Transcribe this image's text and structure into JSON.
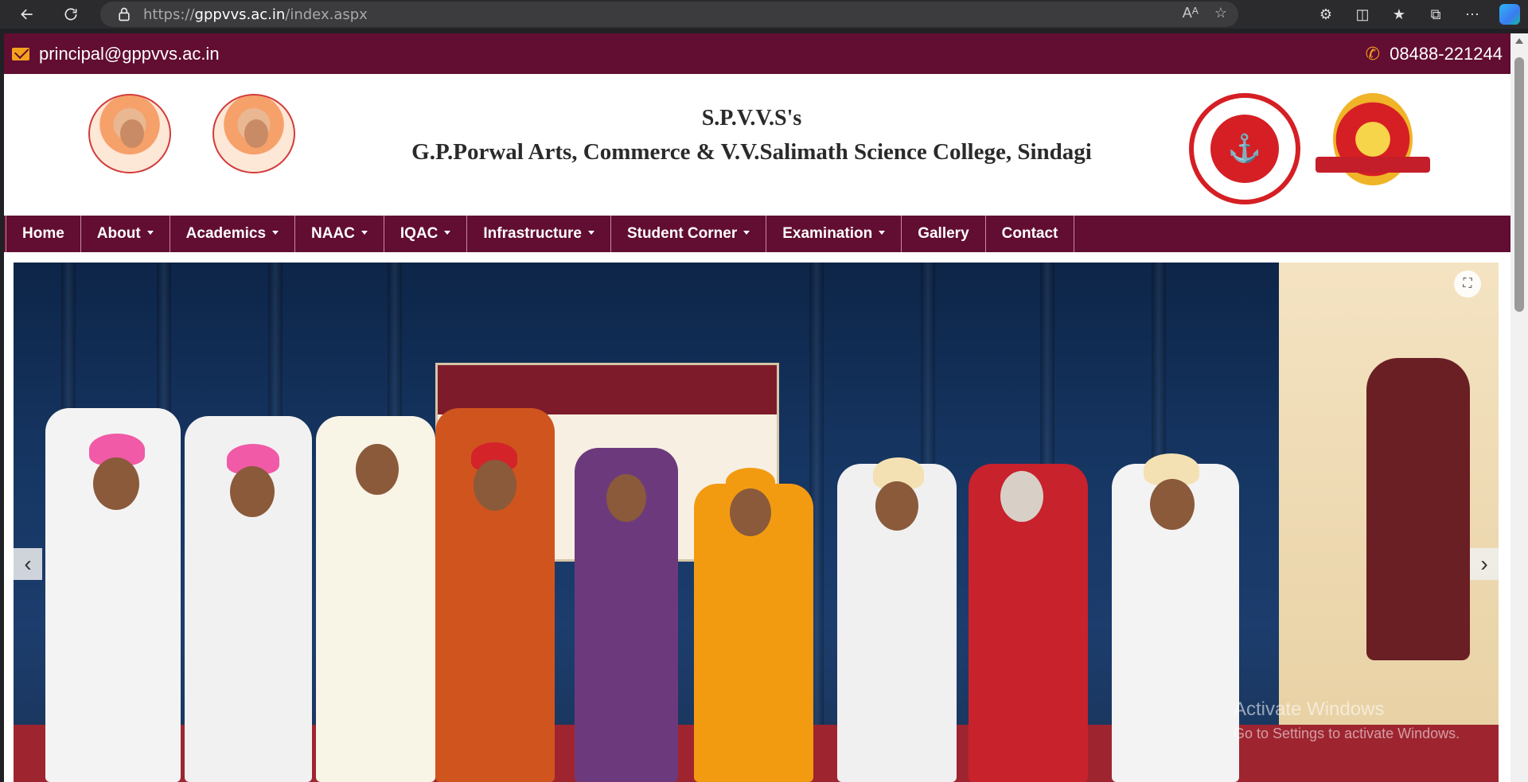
{
  "browser": {
    "url_prefix": "https://",
    "url_host": "gppvvs.ac.in",
    "url_path": "/index.aspx",
    "read_aloud": "Aᴬ"
  },
  "topbar": {
    "email": "principal@gppvvs.ac.in",
    "phone": "08488-221244"
  },
  "header": {
    "line1": "S.P.V.V.S's",
    "line2": "G.P.Porwal Arts, Commerce & V.V.Salimath Science College, Sindagi"
  },
  "nav": {
    "items": [
      {
        "label": "Home",
        "dropdown": false
      },
      {
        "label": "About",
        "dropdown": true
      },
      {
        "label": "Academics",
        "dropdown": true
      },
      {
        "label": "NAAC",
        "dropdown": true
      },
      {
        "label": "IQAC",
        "dropdown": true
      },
      {
        "label": "Infrastructure",
        "dropdown": true
      },
      {
        "label": "Student Corner",
        "dropdown": true
      },
      {
        "label": "Examination",
        "dropdown": true
      },
      {
        "label": "Gallery",
        "dropdown": false
      },
      {
        "label": "Contact",
        "dropdown": false
      }
    ]
  },
  "carousel": {
    "prev_glyph": "‹",
    "next_glyph": "›"
  },
  "watermark": {
    "line1": "Activate Windows",
    "line2": "Go to Settings to activate Windows."
  },
  "colors": {
    "brand": "#620d32",
    "accent": "#f4a21d"
  }
}
